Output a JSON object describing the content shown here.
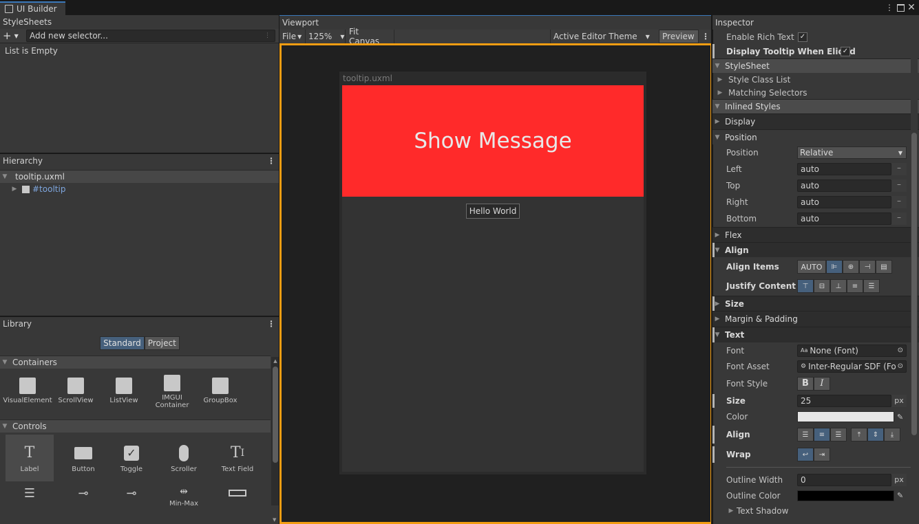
{
  "window": {
    "tab_title": "UI Builder",
    "tab_icon": "ui-builder-icon"
  },
  "stylesheets": {
    "title": "StyleSheets",
    "add_selector_placeholder": "Add new selector...",
    "empty_text": "List is Empty"
  },
  "hierarchy": {
    "title": "Hierarchy",
    "root": "tooltip.uxml",
    "child": "#tooltip"
  },
  "library": {
    "title": "Library",
    "tabs": [
      "Standard",
      "Project"
    ],
    "containers_label": "Containers",
    "containers": [
      "VisualElement",
      "ScrollView",
      "ListView",
      "IMGUI Container",
      "GroupBox"
    ],
    "controls_label": "Controls",
    "controls": [
      "Label",
      "Button",
      "Toggle",
      "Scroller",
      "Text Field"
    ],
    "row3_partial": [
      "",
      "",
      "",
      "Min-Max",
      ""
    ]
  },
  "viewport": {
    "title": "Viewport",
    "file_menu": "File",
    "zoom": "125%",
    "fit_canvas": "Fit Canvas",
    "theme": "Active Editor Theme",
    "preview": "Preview",
    "canvas_title": "tooltip.uxml",
    "button_text": "Show Message",
    "tooltip_text": "Hello World",
    "colors": {
      "selection_border": "#f29d12",
      "button_bg": "#ff2a2a",
      "canvas_bg": "#333333",
      "viewport_bg": "#202020"
    }
  },
  "inspector": {
    "title": "Inspector",
    "enable_rich_text": "Enable Rich Text",
    "display_tooltip": "Display Tooltip When Elided",
    "stylesheet_section": "StyleSheet",
    "style_class_list": "Style Class List",
    "matching_selectors": "Matching Selectors",
    "inlined_styles": "Inlined Styles",
    "display": "Display",
    "position_section": "Position",
    "position_label": "Position",
    "position_value": "Relative",
    "left_label": "Left",
    "left_value": "auto",
    "top_label": "Top",
    "top_value": "auto",
    "right_label": "Right",
    "right_value": "auto",
    "bottom_label": "Bottom",
    "bottom_value": "auto",
    "flex": "Flex",
    "align_section": "Align",
    "align_items": "Align Items",
    "align_items_auto": "AUTO",
    "justify_content": "Justify Content",
    "size_section": "Size",
    "margin_padding": "Margin & Padding",
    "text_section": "Text",
    "font_label": "Font",
    "font_value": "None (Font)",
    "font_asset_label": "Font Asset",
    "font_asset_value": "Inter-Regular SDF (Fo",
    "font_style_label": "Font Style",
    "bold_glyph": "B",
    "italic_glyph": "I",
    "size_label": "Size",
    "size_value": "25",
    "px": "px",
    "color_label": "Color",
    "color_value": "#e6e6e6",
    "align_label": "Align",
    "wrap_label": "Wrap",
    "outline_width_label": "Outline Width",
    "outline_width_value": "0",
    "outline_color_label": "Outline Color",
    "outline_color_value": "#000000",
    "text_shadow": "Text Shadow"
  }
}
